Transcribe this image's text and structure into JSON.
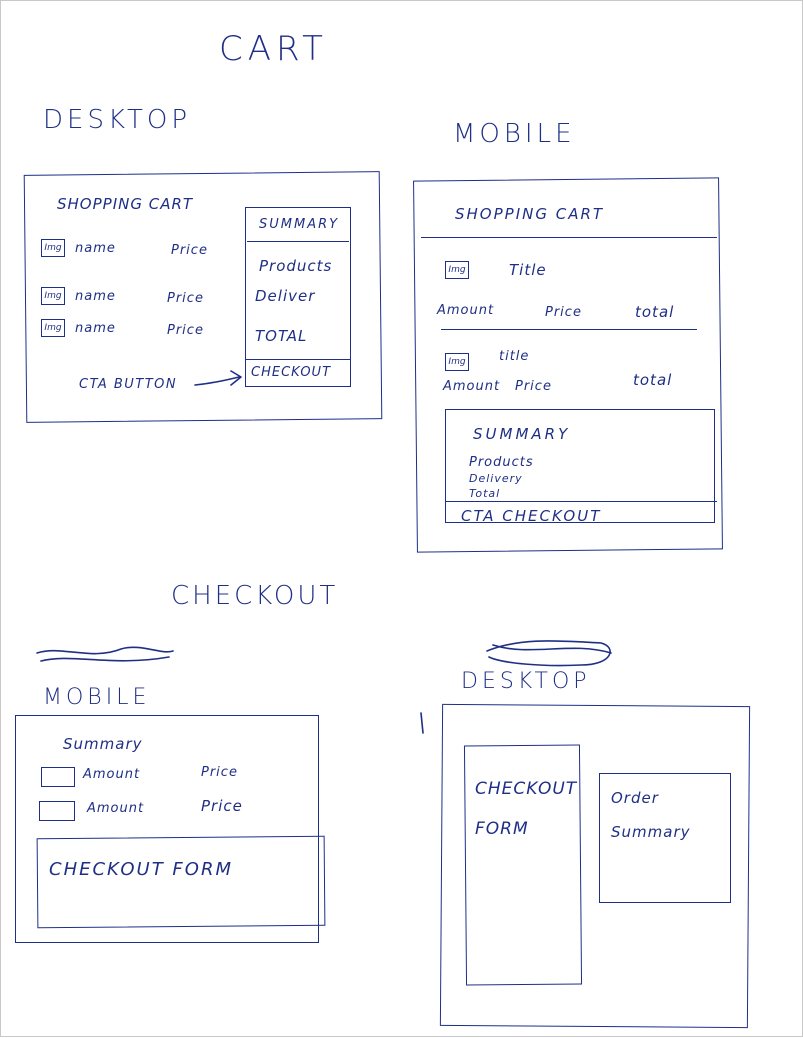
{
  "cart": {
    "heading": "CART",
    "desktop": {
      "label": "DESKTOP",
      "list_title": "SHOPPING CART",
      "rows": [
        {
          "img": "Img",
          "name": "name",
          "price": "Price"
        },
        {
          "img": "Img",
          "name": "name",
          "price": "Price"
        },
        {
          "img": "Img",
          "name": "name",
          "price": "Price"
        }
      ],
      "summary": {
        "title": "SUMMARY",
        "products": "Products",
        "delivery": "Deliver",
        "total": "TOTAL",
        "checkout": "CHECKOUT"
      },
      "cta_note": "CTA BUTTON"
    },
    "mobile": {
      "label": "MOBILE",
      "list_title": "SHOPPING CART",
      "items": [
        {
          "img": "Img",
          "title": "Title",
          "amount": "Amount",
          "price": "Price",
          "total": "total"
        },
        {
          "img": "Img",
          "title": "title",
          "amount": "Amount",
          "price": "Price",
          "total": "total"
        }
      ],
      "summary": {
        "title": "SUMMARY",
        "products": "Products",
        "delivery": "Delivery",
        "total": "Total",
        "cta": "CTA CHECKOUT"
      }
    }
  },
  "checkout": {
    "heading": "CHECKOUT",
    "mobile": {
      "label": "MOBILE",
      "summary_title": "Summary",
      "rows": [
        {
          "amount": "Amount",
          "price": "Price"
        },
        {
          "amount": "Amount",
          "price": "Price"
        }
      ],
      "form": "CHECKOUT FORM"
    },
    "desktop": {
      "label": "DESKTOP",
      "form": "CHECKOUT FORM",
      "order_summary": "Order Summary"
    }
  }
}
